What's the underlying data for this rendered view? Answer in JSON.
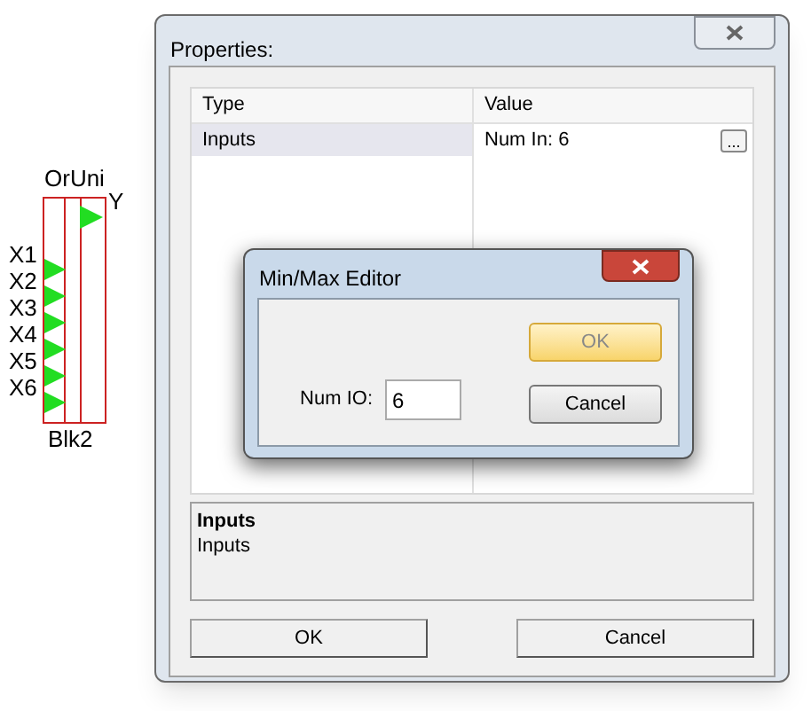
{
  "block": {
    "title": "OrUni",
    "name": "Blk2",
    "output": "Y",
    "inputs": [
      "X1",
      "X2",
      "X3",
      "X4",
      "X5",
      "X6"
    ]
  },
  "properties": {
    "title": "Properties:",
    "columns": [
      "Type",
      "Value"
    ],
    "rows": [
      {
        "type": "Inputs",
        "value": "Num In: 6",
        "button": "...",
        "selected": true
      }
    ],
    "description": {
      "title": "Inputs",
      "text": "Inputs"
    },
    "buttons": [
      "OK",
      "Cancel"
    ]
  },
  "editor": {
    "title": "Min/Max Editor",
    "field_label": "Num IO:",
    "field_value": "6",
    "buttons": [
      {
        "label": "OK",
        "default": true
      },
      {
        "label": "Cancel",
        "default": false
      }
    ]
  }
}
